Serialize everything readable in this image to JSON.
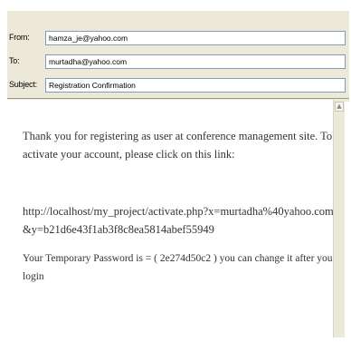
{
  "header": {
    "from_label": "From:",
    "from_value": "hamza_je@yahoo.com",
    "to_label": "To:",
    "to_value": "murtadha@yahoo.com",
    "subject_label": "Subject:",
    "subject_value": "Registration Confirmation"
  },
  "body": {
    "paragraph1": "Thank you for registering as user at conference management site. To activate your account, please click on this link:",
    "link": "http://localhost/my_project/activate.php?x=murtadha%40yahoo.com&y=b21d6e43f1ab3f8c8ea5814abef55949",
    "paragraph3": "Your Temporary Password is = ( 2e274d50c2 ) you can change it after you login"
  },
  "scrollbar": {
    "up_arrow_icon": "chevron-up-icon"
  }
}
